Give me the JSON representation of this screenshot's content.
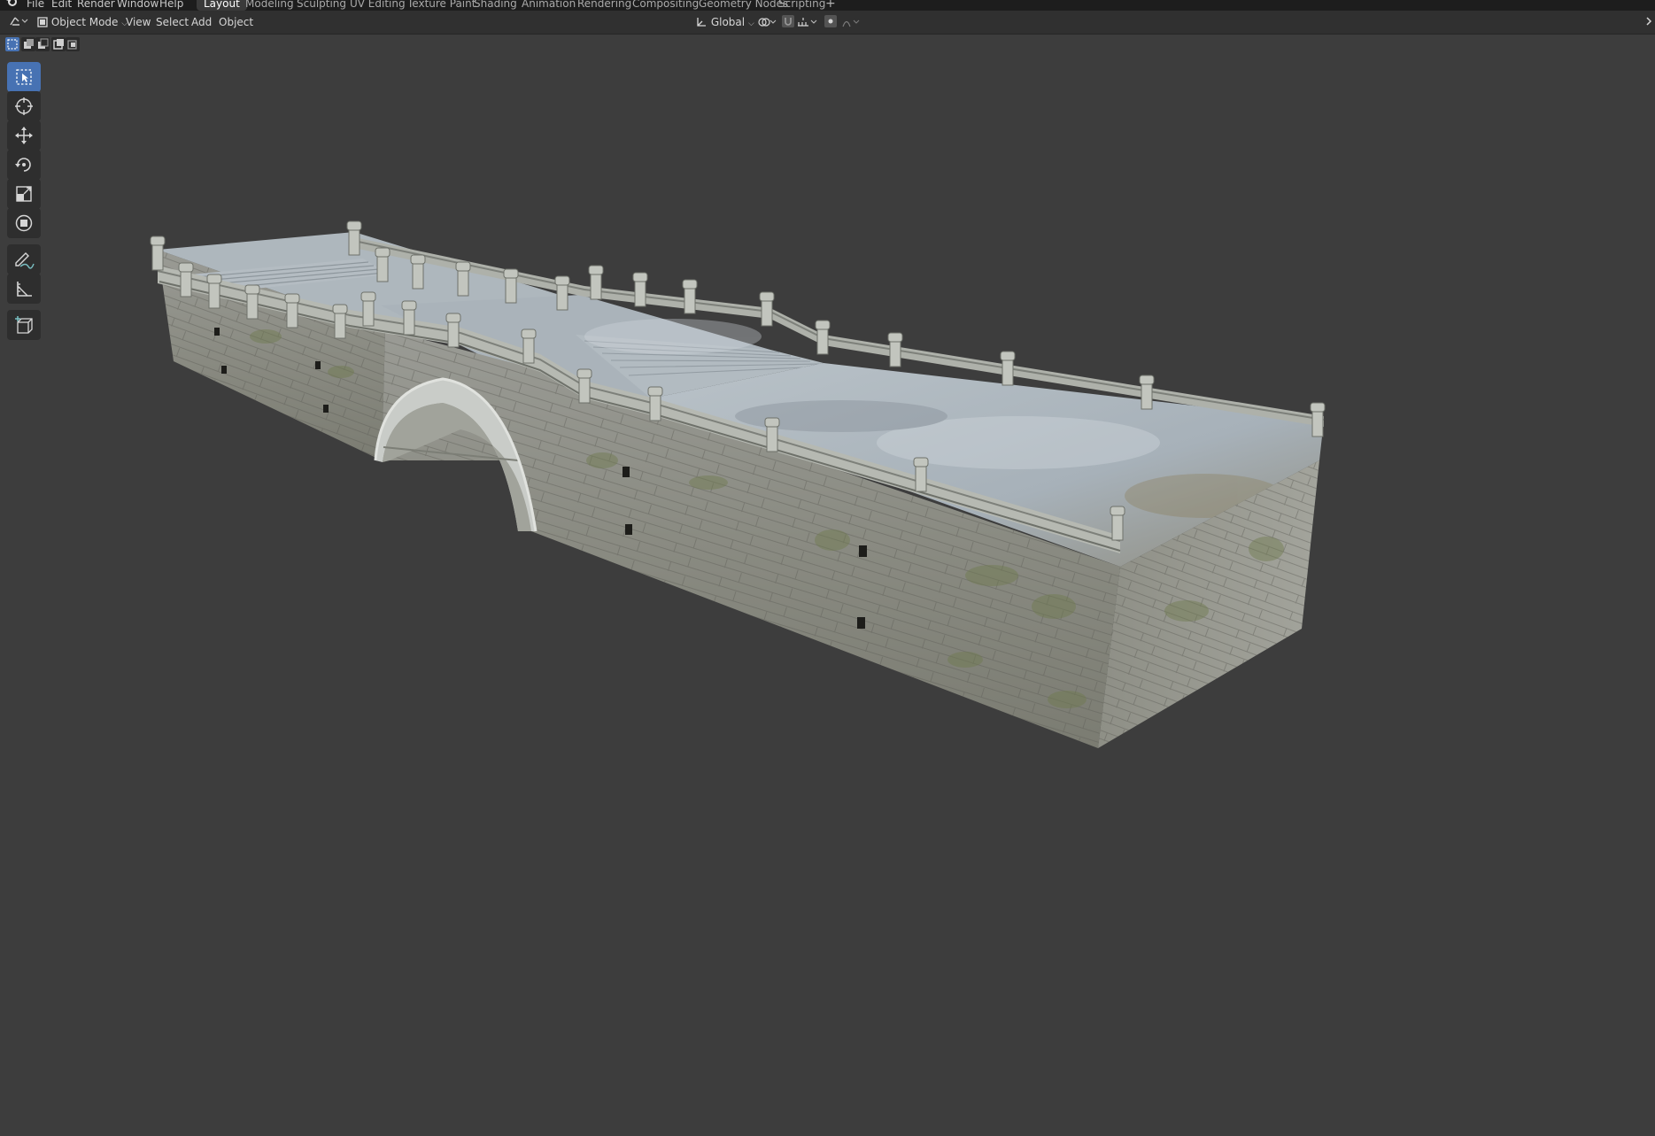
{
  "menu": {
    "items": [
      "File",
      "Edit",
      "Render",
      "Window",
      "Help"
    ]
  },
  "workspaces": {
    "tabs": [
      "Layout",
      "Modeling",
      "Sculpting",
      "UV Editing",
      "Texture Paint",
      "Shading",
      "Animation",
      "Rendering",
      "Compositing",
      "Geometry Nodes",
      "Scripting"
    ],
    "active": "Layout",
    "add_symbol": "+"
  },
  "header": {
    "mode": "Object Mode",
    "menus": [
      "View",
      "Select",
      "Add",
      "Object"
    ],
    "orientation": "Global"
  },
  "colors": {
    "background": "#3d3d3d",
    "topbar": "#1d1d1d",
    "header": "#303030",
    "accent_active": "#4772b3",
    "stone": "#8f918a",
    "deck": "#a9b2b8",
    "moss": "#6f7a4e"
  },
  "icons": {
    "tools": [
      "select-box-icon",
      "cursor-icon",
      "move-icon",
      "rotate-icon",
      "scale-icon",
      "transform-icon",
      "annotate-icon",
      "measure-icon",
      "add-cube-icon"
    ],
    "select_modes": [
      "select-new-icon",
      "select-extend-icon",
      "select-subtract-icon",
      "select-invert-icon",
      "select-intersect-icon"
    ]
  }
}
